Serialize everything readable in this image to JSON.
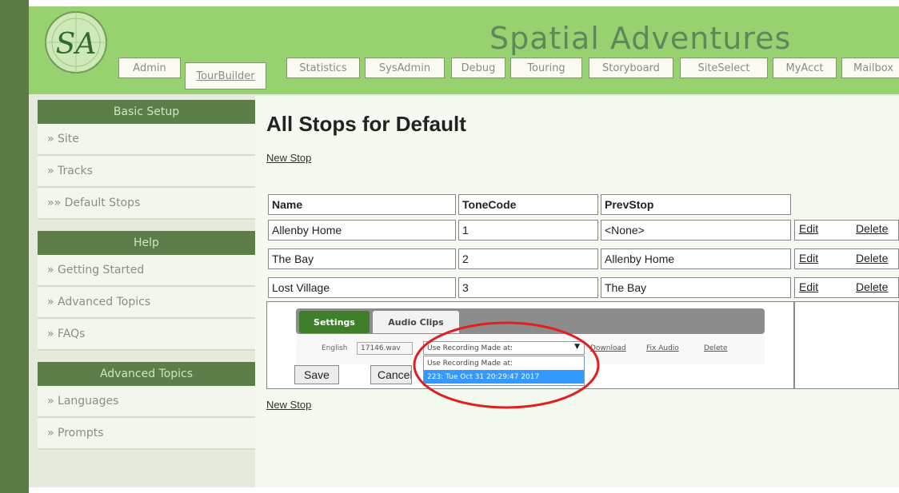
{
  "app": {
    "logo_text": "SA",
    "title": "Spatial Adventures"
  },
  "nav": {
    "tabs": [
      "Admin",
      "TourBuilder",
      "Statistics",
      "SysAdmin",
      "Debug",
      "Touring",
      "Storyboard",
      "SiteSelect",
      "MyAcct",
      "Mailbox"
    ],
    "active": "TourBuilder"
  },
  "sidebar": {
    "sections": [
      {
        "title": "Basic Setup",
        "items": [
          "» Site",
          "» Tracks",
          "»» Default Stops"
        ]
      },
      {
        "title": "Help",
        "items": [
          "» Getting Started",
          "» Advanced Topics",
          "» FAQs"
        ]
      },
      {
        "title": "Advanced Topics",
        "items": [
          "» Languages",
          "» Prompts"
        ]
      }
    ]
  },
  "main": {
    "title": "All Stops for Default",
    "new_stop_label": "New Stop",
    "table": {
      "headers": [
        "Name",
        "ToneCode",
        "PrevStop"
      ],
      "rows": [
        {
          "name": "Allenby Home",
          "tonecode": "1",
          "prevstop": "<None>"
        },
        {
          "name": "The Bay",
          "tonecode": "2",
          "prevstop": "Allenby Home"
        },
        {
          "name": "Lost Village",
          "tonecode": "3",
          "prevstop": "The Bay"
        }
      ],
      "edit_label": "Edit",
      "delete_label": "Delete"
    },
    "editor": {
      "tab_settings": "Settings",
      "tab_audio": "Audio Clips",
      "language_label": "English",
      "clip_file": "17146.wav",
      "select_value": "Use Recording Made at:",
      "dropdown_options": [
        "Use Recording Made at:",
        "223: Tue Oct 31 20:29:47 2017"
      ],
      "download_label": "Download",
      "fix_audio_label": "Fix Audio",
      "delete_label": "Delete",
      "save_label": "Save",
      "cancel_label": "Cancel"
    }
  },
  "colors": {
    "header_green": "#98d270",
    "sidebar_head": "#5d7e48",
    "selected_option": "#3399ff",
    "annotation_red": "#e02020"
  }
}
